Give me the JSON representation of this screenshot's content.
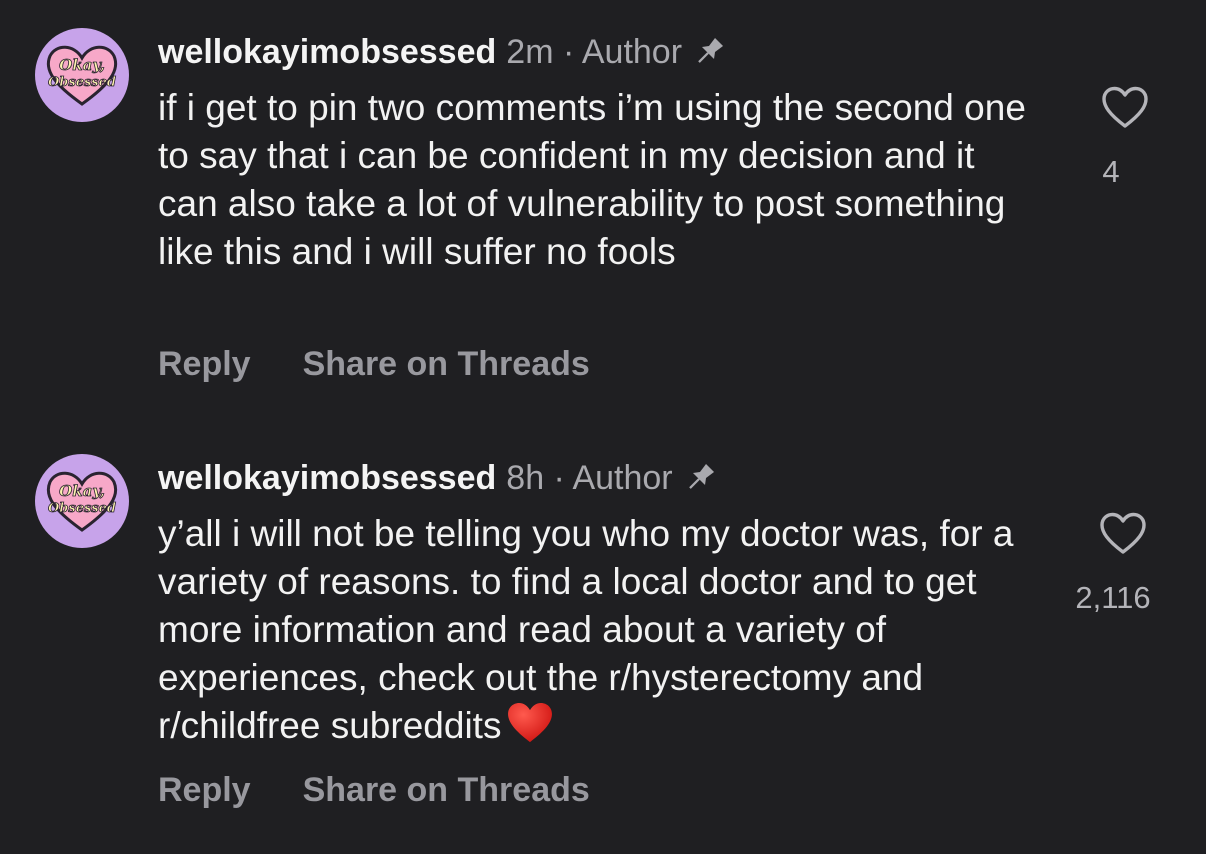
{
  "colors": {
    "background": "#1f1f22",
    "text": "#f2f2f2",
    "muted": "#a9a9ae",
    "avatar_bg": "#c7a3ea",
    "heart_red": "#e0201e"
  },
  "comments": [
    {
      "avatar_icon": "okay-obsessed-avatar",
      "avatar_logo_text": "Okay, Obsessed",
      "username": "wellokayimobsessed",
      "meta": "2m · Author",
      "pin_icon": "pin-icon",
      "text": "if i get to pin two comments i’m using the second one to say that i can be confident in my decision and it can also take a lot of vulnerability to post something like this and i will suffer no fools",
      "like_icon": "heart-outline-icon",
      "likes": "4",
      "reply_label": "Reply",
      "share_label": "Share on Threads"
    },
    {
      "avatar_icon": "okay-obsessed-avatar",
      "avatar_logo_text": "Okay, Obsessed",
      "username": "wellokayimobsessed",
      "meta": "8h · Author",
      "pin_icon": "pin-icon",
      "text": "y’all i will not be telling you who my doctor was, for a variety of reasons. to find a local doctor and to get more information and read about a variety of experiences, check out the r/hysterectomy and r/childfree subreddits",
      "emoji": "red-heart-emoji",
      "like_icon": "heart-outline-icon",
      "likes": "2,116",
      "reply_label": "Reply",
      "share_label": "Share on Threads"
    }
  ]
}
